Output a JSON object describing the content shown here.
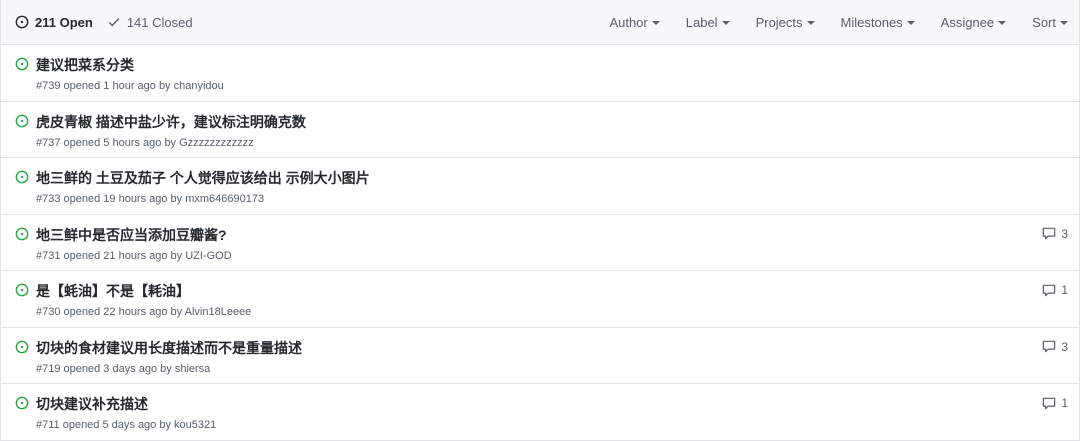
{
  "header": {
    "open_label": "211 Open",
    "closed_label": "141 Closed",
    "filters": [
      "Author",
      "Label",
      "Projects",
      "Milestones",
      "Assignee",
      "Sort"
    ]
  },
  "colors": {
    "open_icon": "#28a745",
    "muted_text": "#586069",
    "header_bg": "#f6f8fa",
    "border": "#e1e4e8"
  },
  "issues": [
    {
      "title": "建议把菜系分类",
      "meta": "#739 opened 1 hour ago by chanyidou",
      "comments": ""
    },
    {
      "title": "虎皮青椒 描述中盐少许，建议标注明确克数",
      "meta": "#737 opened 5 hours ago by Gzzzzzzzzzzzz",
      "comments": ""
    },
    {
      "title": "地三鲜的 土豆及茄子 个人觉得应该给出 示例大小图片",
      "meta": "#733 opened 19 hours ago by mxm646690173",
      "comments": ""
    },
    {
      "title": "地三鲜中是否应当添加豆瓣酱?",
      "meta": "#731 opened 21 hours ago by UZI-GOD",
      "comments": "3"
    },
    {
      "title": "是【蚝油】不是【耗油】",
      "meta": "#730 opened 22 hours ago by Alvin18Leeee",
      "comments": "1"
    },
    {
      "title": "切块的食材建议用长度描述而不是重量描述",
      "meta": "#719 opened 3 days ago by shiersa",
      "comments": "3"
    },
    {
      "title": "切块建议补充描述",
      "meta": "#711 opened 5 days ago by kou5321",
      "comments": "1"
    }
  ]
}
